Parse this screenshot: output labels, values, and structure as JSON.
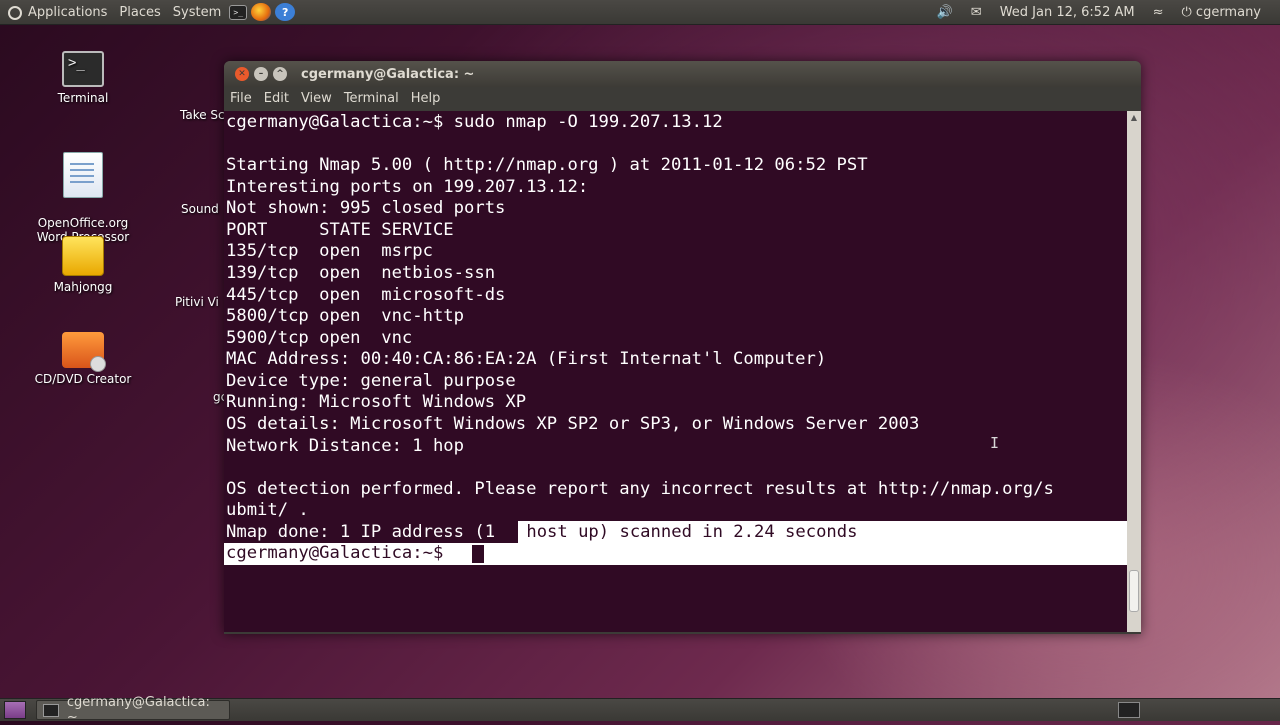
{
  "top_panel": {
    "applications": "Applications",
    "places": "Places",
    "system": "System",
    "launchers": [
      "terminal-icon",
      "firefox-icon",
      "help-icon"
    ],
    "status_icons": [
      "volume-icon",
      "mail-icon"
    ],
    "datetime": "Wed Jan 12,  6:52 AM",
    "user": "cgermany"
  },
  "desktop": {
    "icons": [
      {
        "label": "Terminal"
      },
      {
        "label": "OpenOffice.org\nWord Processor"
      },
      {
        "label": "Mahjongg"
      },
      {
        "label": "CD/DVD Creator"
      }
    ],
    "partial_labels": [
      "Take Sc",
      "Sound",
      "Pitivi Vi",
      "gc"
    ]
  },
  "window": {
    "title": "cgermany@Galactica: ~",
    "menu": [
      "File",
      "Edit",
      "View",
      "Terminal",
      "Help"
    ],
    "lines": [
      "cgermany@Galactica:~$ sudo nmap -O 199.207.13.12",
      "",
      "Starting Nmap 5.00 ( http://nmap.org ) at 2011-01-12 06:52 PST",
      "Interesting ports on 199.207.13.12:",
      "Not shown: 995 closed ports",
      "PORT     STATE SERVICE",
      "135/tcp  open  msrpc",
      "139/tcp  open  netbios-ssn",
      "445/tcp  open  microsoft-ds",
      "5800/tcp open  vnc-http",
      "5900/tcp open  vnc",
      "MAC Address: 00:40:CA:86:EA:2A (First Internat'l Computer)",
      "Device type: general purpose",
      "Running: Microsoft Windows XP",
      "OS details: Microsoft Windows XP SP2 or SP3, or Windows Server 2003",
      "Network Distance: 1 hop",
      "",
      "OS detection performed. Please report any incorrect results at http://nmap.org/s",
      "ubmit/ .",
      "Nmap done: 1 IP address (1",
      "cgermany@Galactica:~$"
    ],
    "selected_tail": " host up) scanned in 2.24 seconds"
  },
  "taskbar": {
    "task_label": "cgermany@Galactica: ~"
  }
}
